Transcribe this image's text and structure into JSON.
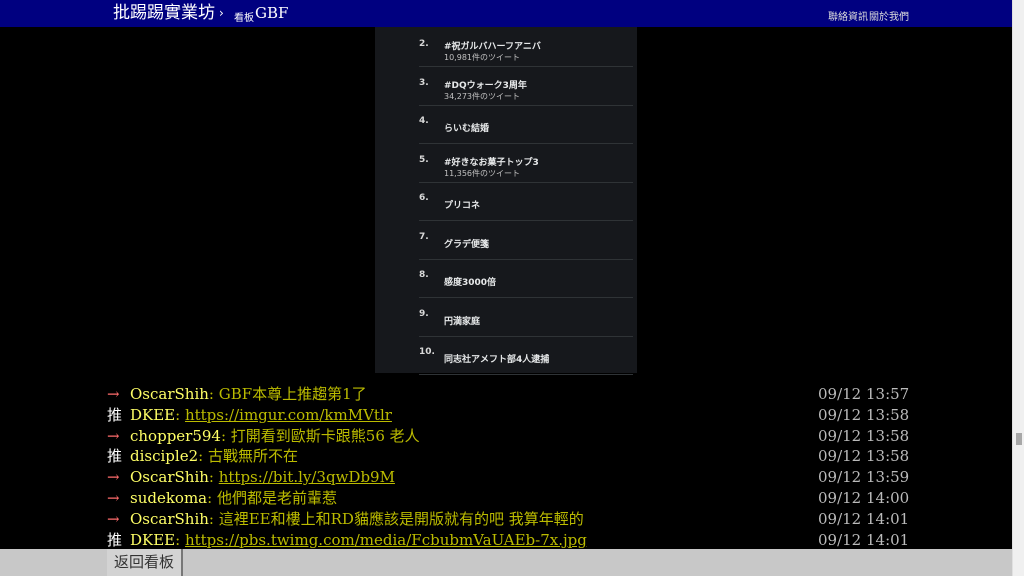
{
  "header": {
    "site_title": "批踢踢實業坊",
    "separator": "›",
    "board_prefix": "看板",
    "board_name": "GBF",
    "links": [
      "聯絡資訊",
      "關於我們"
    ],
    "background": "#000080"
  },
  "trend_image": {
    "trends": [
      {
        "rank": "2.",
        "title": "#祝ガルバハーフアニバ",
        "count": "10,981件のツイート"
      },
      {
        "rank": "3.",
        "title": "#DQウォーク3周年",
        "count": "34,273件のツイート"
      },
      {
        "rank": "4.",
        "title": "らいむ結婚",
        "count": ""
      },
      {
        "rank": "5.",
        "title": "#好きなお菓子トップ3",
        "count": "11,356件のツイート"
      },
      {
        "rank": "6.",
        "title": "プリコネ",
        "count": ""
      },
      {
        "rank": "7.",
        "title": "グラデ便箋",
        "count": ""
      },
      {
        "rank": "8.",
        "title": "感度3000倍",
        "count": ""
      },
      {
        "rank": "9.",
        "title": "円満家庭",
        "count": ""
      },
      {
        "rank": "10.",
        "title": "同志社アメフト部4人逮捕",
        "count": ""
      }
    ]
  },
  "comments": [
    {
      "tag": "→",
      "user": "OscarShih",
      "content": ": GBF本尊上推趨第1了",
      "link": "",
      "time": "09/12 13:57"
    },
    {
      "tag": "推",
      "user": "DKEE",
      "content": ": ",
      "link": "https://imgur.com/kmMVtlr",
      "time": "09/12 13:58"
    },
    {
      "tag": "→",
      "user": "chopper594",
      "content": ": 打開看到歐斯卡跟熊56  老人",
      "link": "",
      "time": "09/12 13:58"
    },
    {
      "tag": "推",
      "user": "disciple2",
      "content": ": 古戰無所不在",
      "link": "",
      "time": "09/12 13:58"
    },
    {
      "tag": "→",
      "user": "OscarShih",
      "content": ": ",
      "link": "https://bit.ly/3qwDb9M",
      "time": "09/12 13:59"
    },
    {
      "tag": "→",
      "user": "sudekoma",
      "content": ": 他們都是老前輩惹",
      "link": "",
      "time": "09/12 14:00"
    },
    {
      "tag": "→",
      "user": "OscarShih",
      "content": ": 這裡EE和樓上和RD貓應該是開版就有的吧 我算年輕的",
      "link": "",
      "time": "09/12 14:01"
    },
    {
      "tag": "推",
      "user": "DKEE",
      "content": ": ",
      "link": "https://pbs.twimg.com/media/FcbubmVaUAEb-7x.jpg",
      "time": "09/12 14:01"
    }
  ],
  "footer": {
    "back_label": "返回看板"
  },
  "colors": {
    "push_arrow": "#ff6b6b",
    "user": "#ffff66",
    "content": "#bbbb00"
  }
}
